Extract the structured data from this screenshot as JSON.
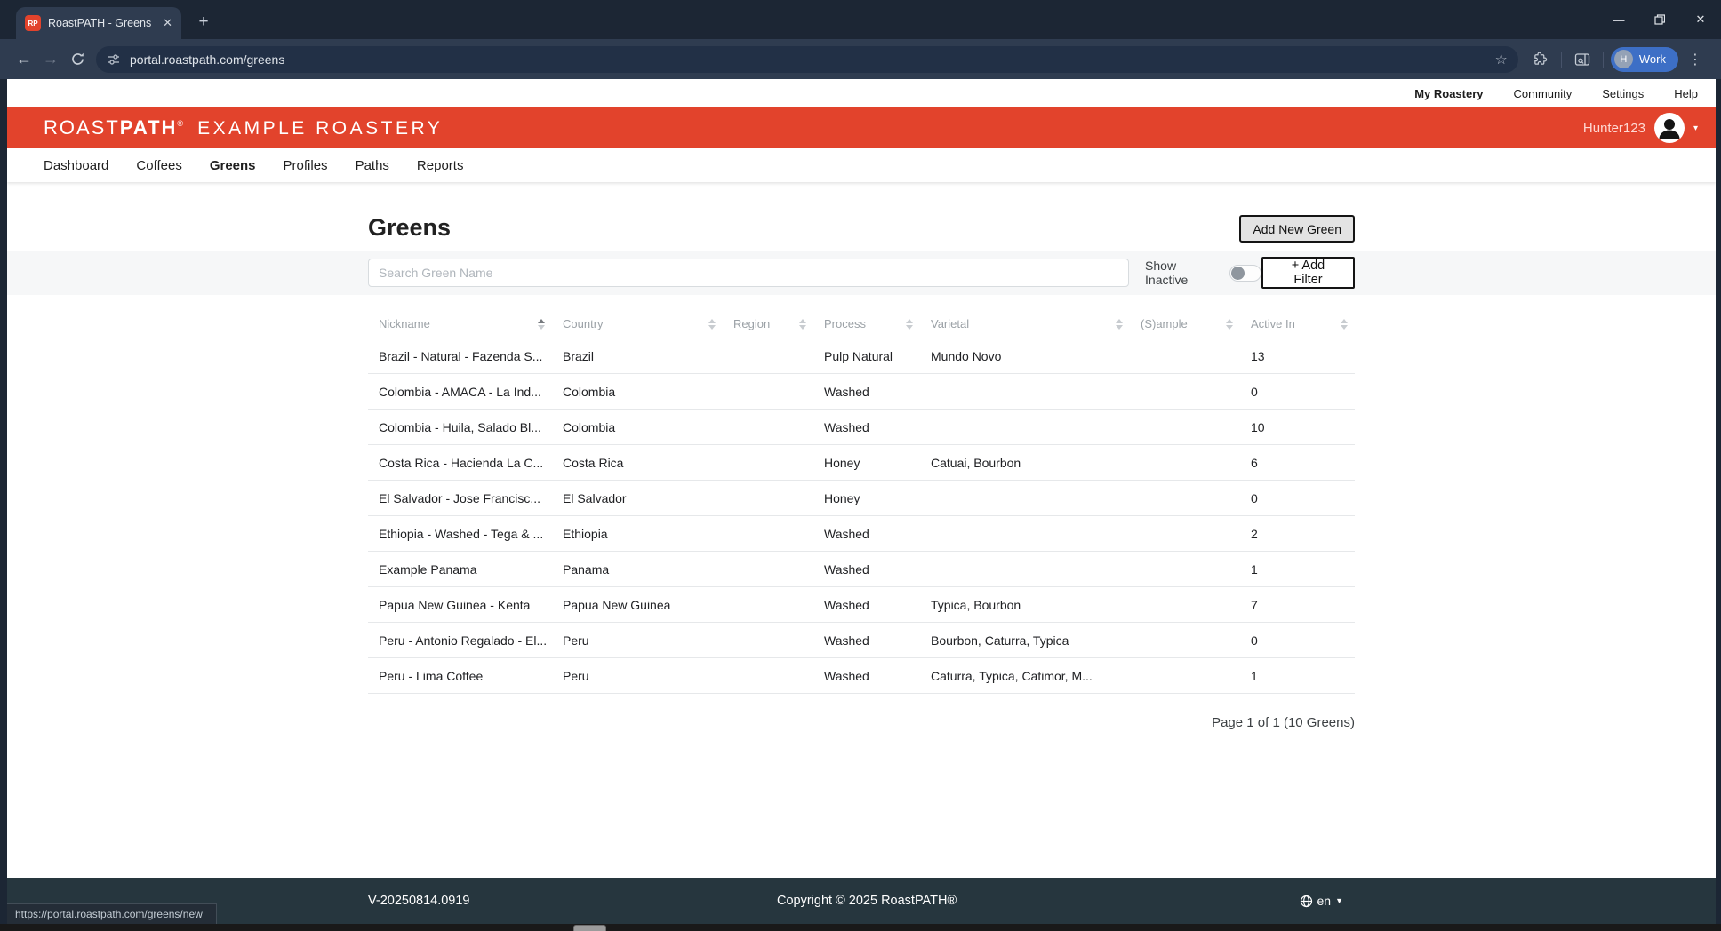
{
  "colors": {
    "brand_red": "#e2432c",
    "chrome_bg": "#1c2634",
    "chrome_surface": "#2f3c50",
    "omnibox": "#223046",
    "footer_bg": "#26363e",
    "chip_blue": "#3d6fc6"
  },
  "browser": {
    "tab_title": "RoastPATH - Greens",
    "favicon_text": "RP",
    "url": "portal.roastpath.com/greens",
    "profile_initial": "H",
    "profile_label": "Work",
    "status_url": "https://portal.roastpath.com/greens/new"
  },
  "utility_nav": {
    "items": [
      {
        "label": "My Roastery",
        "active": true
      },
      {
        "label": "Community",
        "active": false
      },
      {
        "label": "Settings",
        "active": false
      },
      {
        "label": "Help",
        "active": false
      }
    ]
  },
  "brand": {
    "logo_roast": "ROAST",
    "logo_path": "PATH",
    "logo_reg": "®",
    "roastery_name": "EXAMPLE ROASTERY",
    "username": "Hunter123"
  },
  "main_nav": {
    "items": [
      {
        "label": "Dashboard",
        "active": false
      },
      {
        "label": "Coffees",
        "active": false
      },
      {
        "label": "Greens",
        "active": true
      },
      {
        "label": "Profiles",
        "active": false
      },
      {
        "label": "Paths",
        "active": false
      },
      {
        "label": "Reports",
        "active": false
      }
    ]
  },
  "page": {
    "title": "Greens",
    "add_button_label": "Add New Green",
    "search_placeholder": "Search Green Name",
    "show_inactive_label": "Show Inactive",
    "show_inactive_on": false,
    "add_filter_label": "+ Add Filter",
    "pagination": "Page 1 of 1 (10 Greens)"
  },
  "table": {
    "columns": [
      "Nickname",
      "Country",
      "Region",
      "Process",
      "Varietal",
      "(S)ample",
      "Active In"
    ],
    "column_keys": [
      "nickname",
      "country",
      "region",
      "process",
      "varietal",
      "sample",
      "active_in"
    ],
    "sorted_column_index": 0,
    "sorted_direction": "asc",
    "rows": [
      {
        "nickname": "Brazil - Natural - Fazenda S...",
        "country": "Brazil",
        "region": "",
        "process": "Pulp Natural",
        "varietal": "Mundo Novo",
        "sample": "",
        "active_in": "13"
      },
      {
        "nickname": "Colombia - AMACA - La Ind...",
        "country": "Colombia",
        "region": "",
        "process": "Washed",
        "varietal": "",
        "sample": "",
        "active_in": "0"
      },
      {
        "nickname": "Colombia - Huila, Salado Bl...",
        "country": "Colombia",
        "region": "",
        "process": "Washed",
        "varietal": "",
        "sample": "",
        "active_in": "10"
      },
      {
        "nickname": "Costa Rica - Hacienda La C...",
        "country": "Costa Rica",
        "region": "",
        "process": "Honey",
        "varietal": "Catuai, Bourbon",
        "sample": "",
        "active_in": "6"
      },
      {
        "nickname": "El Salvador - Jose Francisc...",
        "country": "El Salvador",
        "region": "",
        "process": "Honey",
        "varietal": "",
        "sample": "",
        "active_in": "0"
      },
      {
        "nickname": "Ethiopia - Washed - Tega & ...",
        "country": "Ethiopia",
        "region": "",
        "process": "Washed",
        "varietal": "",
        "sample": "",
        "active_in": "2"
      },
      {
        "nickname": "Example Panama",
        "country": "Panama",
        "region": "",
        "process": "Washed",
        "varietal": "",
        "sample": "",
        "active_in": "1"
      },
      {
        "nickname": "Papua New Guinea - Kenta",
        "country": "Papua New Guinea",
        "region": "",
        "process": "Washed",
        "varietal": "Typica, Bourbon",
        "sample": "",
        "active_in": "7"
      },
      {
        "nickname": "Peru - Antonio Regalado - El...",
        "country": "Peru",
        "region": "",
        "process": "Washed",
        "varietal": "Bourbon, Caturra, Typica",
        "sample": "",
        "active_in": "0"
      },
      {
        "nickname": "Peru - Lima Coffee",
        "country": "Peru",
        "region": "",
        "process": "Washed",
        "varietal": "Caturra, Typica, Catimor, M...",
        "sample": "",
        "active_in": "1"
      }
    ]
  },
  "footer": {
    "version": "V-20250814.0919",
    "copyright": "Copyright © 2025 RoastPATH®",
    "language": "en"
  }
}
